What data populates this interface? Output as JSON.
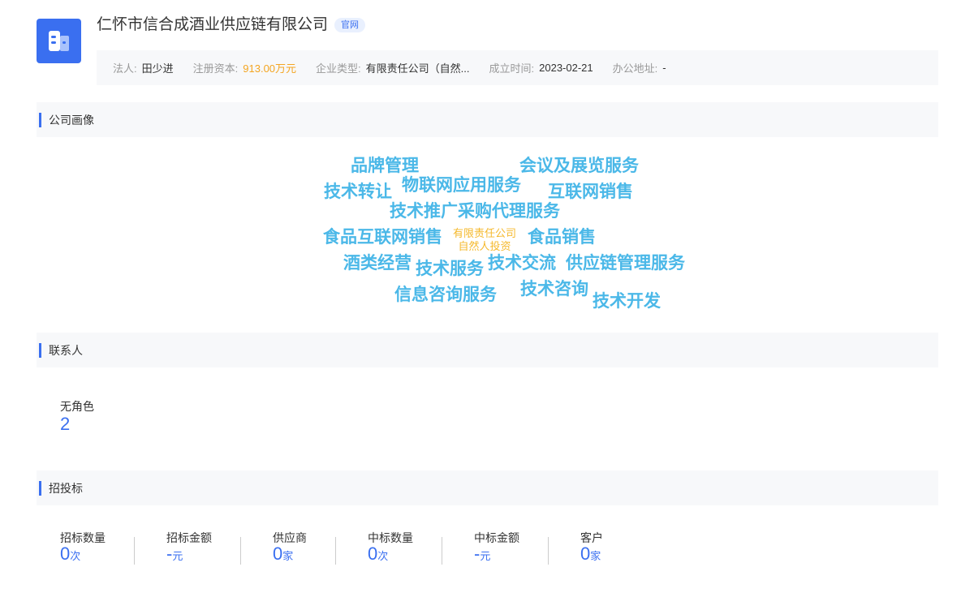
{
  "company": {
    "name": "仁怀市信合成酒业供应链有限公司",
    "tag": "官网",
    "info": [
      {
        "label": "法人:",
        "value": "田少进",
        "accent": false
      },
      {
        "label": "注册资本:",
        "value": "913.00万元",
        "accent": true
      },
      {
        "label": "企业类型:",
        "value": "有限责任公司（自然...",
        "accent": false
      },
      {
        "label": "成立时间:",
        "value": "2023-02-21",
        "accent": false
      },
      {
        "label": "办公地址:",
        "value": "-",
        "accent": false
      }
    ]
  },
  "portrait": {
    "title": "公司画像",
    "words": [
      "品牌管理",
      "会议及展览服务",
      "技术转让",
      "物联网应用服务",
      "互联网销售",
      "技术推广采购代理服务",
      "食品互联网销售",
      "食品销售",
      "酒类经营",
      "技术服务",
      "技术交流",
      "供应链管理服务",
      "信息咨询服务",
      "技术咨询",
      "技术开发"
    ],
    "center_tag": [
      "有限责任公司",
      "自然人投资"
    ]
  },
  "contacts": {
    "title": "联系人",
    "role_label": "无角色",
    "role_count": "2"
  },
  "bidding": {
    "title": "招投标",
    "stats": [
      {
        "label": "招标数量",
        "value": "0",
        "unit": "次"
      },
      {
        "label": "招标金额",
        "value": "-",
        "unit": "元"
      },
      {
        "label": "供应商",
        "value": "0",
        "unit": "家"
      },
      {
        "label": "中标数量",
        "value": "0",
        "unit": "次"
      },
      {
        "label": "中标金额",
        "value": "-",
        "unit": "元"
      },
      {
        "label": "客户",
        "value": "0",
        "unit": "家"
      }
    ]
  },
  "colors": {
    "accent": "#3a6ff0",
    "cloud": "#4bb8e8",
    "orange": "#f5b92d"
  }
}
